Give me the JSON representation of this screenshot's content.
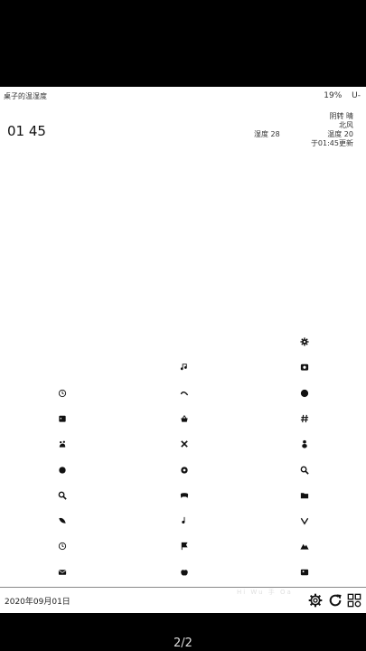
{
  "status": {
    "app_title": "桌子的温湿度",
    "battery": "19%",
    "signal": "U-"
  },
  "clock": "01 45",
  "weather": {
    "line1": "阴转  晴",
    "line2": "北风",
    "humidity_label": "湿度 28",
    "temp_label": "温度 20",
    "updated": "于01:45更新"
  },
  "footer": {
    "date": "2020年09月01日",
    "faint_text": "Hi Wu 手 Oa"
  },
  "page_indicator": "2/2",
  "icons": [
    {
      "name": "gear-icon",
      "col": 3,
      "row": 0
    },
    {
      "name": "music-note-icon",
      "col": 2,
      "row": 1
    },
    {
      "name": "camera-icon",
      "col": 3,
      "row": 1
    },
    {
      "name": "clock-icon",
      "col": 1,
      "row": 2
    },
    {
      "name": "link-icon",
      "col": 2,
      "row": 2
    },
    {
      "name": "globe-icon",
      "col": 3,
      "row": 2
    },
    {
      "name": "calendar-icon",
      "col": 1,
      "row": 3
    },
    {
      "name": "basket-icon",
      "col": 2,
      "row": 3
    },
    {
      "name": "hash-icon",
      "col": 3,
      "row": 3
    },
    {
      "name": "paw-icon",
      "col": 1,
      "row": 4
    },
    {
      "name": "close-icon",
      "col": 2,
      "row": 4
    },
    {
      "name": "person-icon",
      "col": 3,
      "row": 4
    },
    {
      "name": "circle-icon",
      "col": 1,
      "row": 5
    },
    {
      "name": "quote-icon",
      "col": 2,
      "row": 5
    },
    {
      "name": "search-icon",
      "col": 3,
      "row": 5
    },
    {
      "name": "search-icon",
      "col": 1,
      "row": 6
    },
    {
      "name": "gamepad-icon",
      "col": 2,
      "row": 6
    },
    {
      "name": "folder-icon",
      "col": 3,
      "row": 6
    },
    {
      "name": "leaf-icon",
      "col": 1,
      "row": 7
    },
    {
      "name": "note-icon",
      "col": 2,
      "row": 7
    },
    {
      "name": "chevron-down-icon",
      "col": 3,
      "row": 7
    },
    {
      "name": "clock-icon",
      "col": 1,
      "row": 8
    },
    {
      "name": "flag-icon",
      "col": 2,
      "row": 8
    },
    {
      "name": "mountain-icon",
      "col": 3,
      "row": 8
    },
    {
      "name": "mail-icon",
      "col": 1,
      "row": 9
    },
    {
      "name": "apple-icon",
      "col": 2,
      "row": 9
    },
    {
      "name": "image-icon",
      "col": 3,
      "row": 9
    }
  ]
}
